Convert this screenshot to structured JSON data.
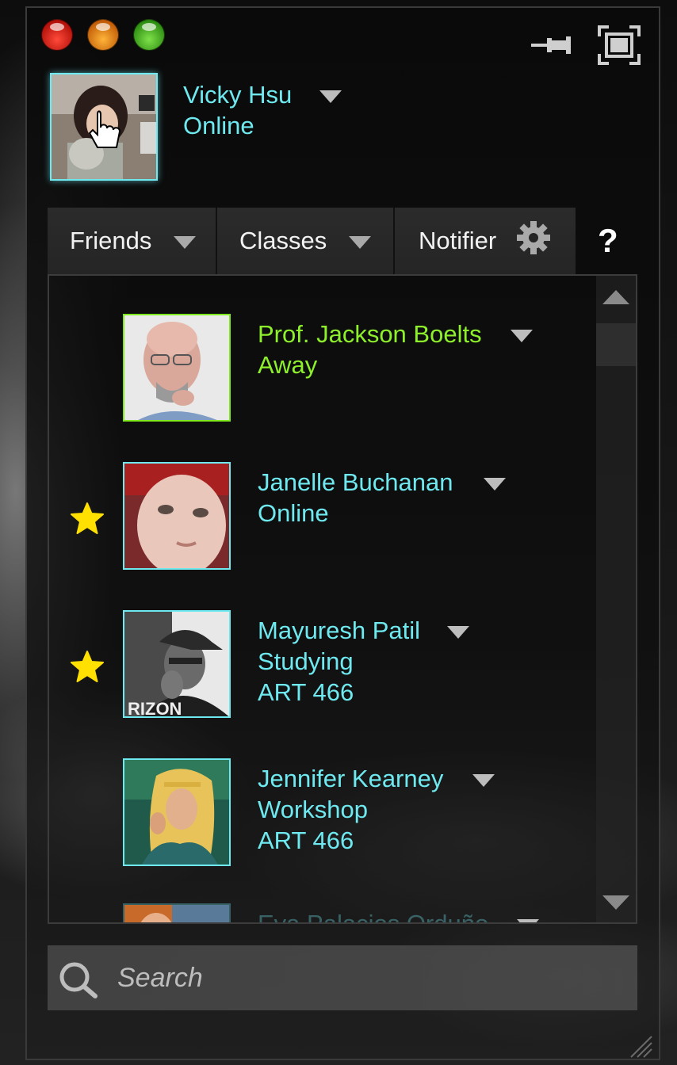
{
  "window": {
    "controls": [
      "close",
      "minimize",
      "zoom"
    ],
    "icons": [
      "pin-icon",
      "fullscreen-icon"
    ]
  },
  "user": {
    "name": "Vicky Hsu",
    "status": "Online"
  },
  "tabs": {
    "friends": "Friends",
    "classes": "Classes",
    "notifier": "Notifier",
    "help": "?"
  },
  "contacts": [
    {
      "name": "Prof. Jackson Boelts",
      "status": "Away",
      "detail": "",
      "starred": false
    },
    {
      "name": "Janelle Buchanan",
      "status": "Online",
      "detail": "",
      "starred": true
    },
    {
      "name": "Mayuresh Patil",
      "status": "Studying",
      "detail": "ART 466",
      "starred": true
    },
    {
      "name": "Jennifer Kearney",
      "status": "Workshop",
      "detail": "ART 466",
      "starred": false
    },
    {
      "name": "Eva Palacios Orduño",
      "status": "",
      "detail": "",
      "starred": false
    }
  ],
  "search": {
    "placeholder": "Search",
    "value": ""
  },
  "colors": {
    "online": "#6fe9f0",
    "away": "#8ef02a",
    "star": "#ffe000"
  }
}
